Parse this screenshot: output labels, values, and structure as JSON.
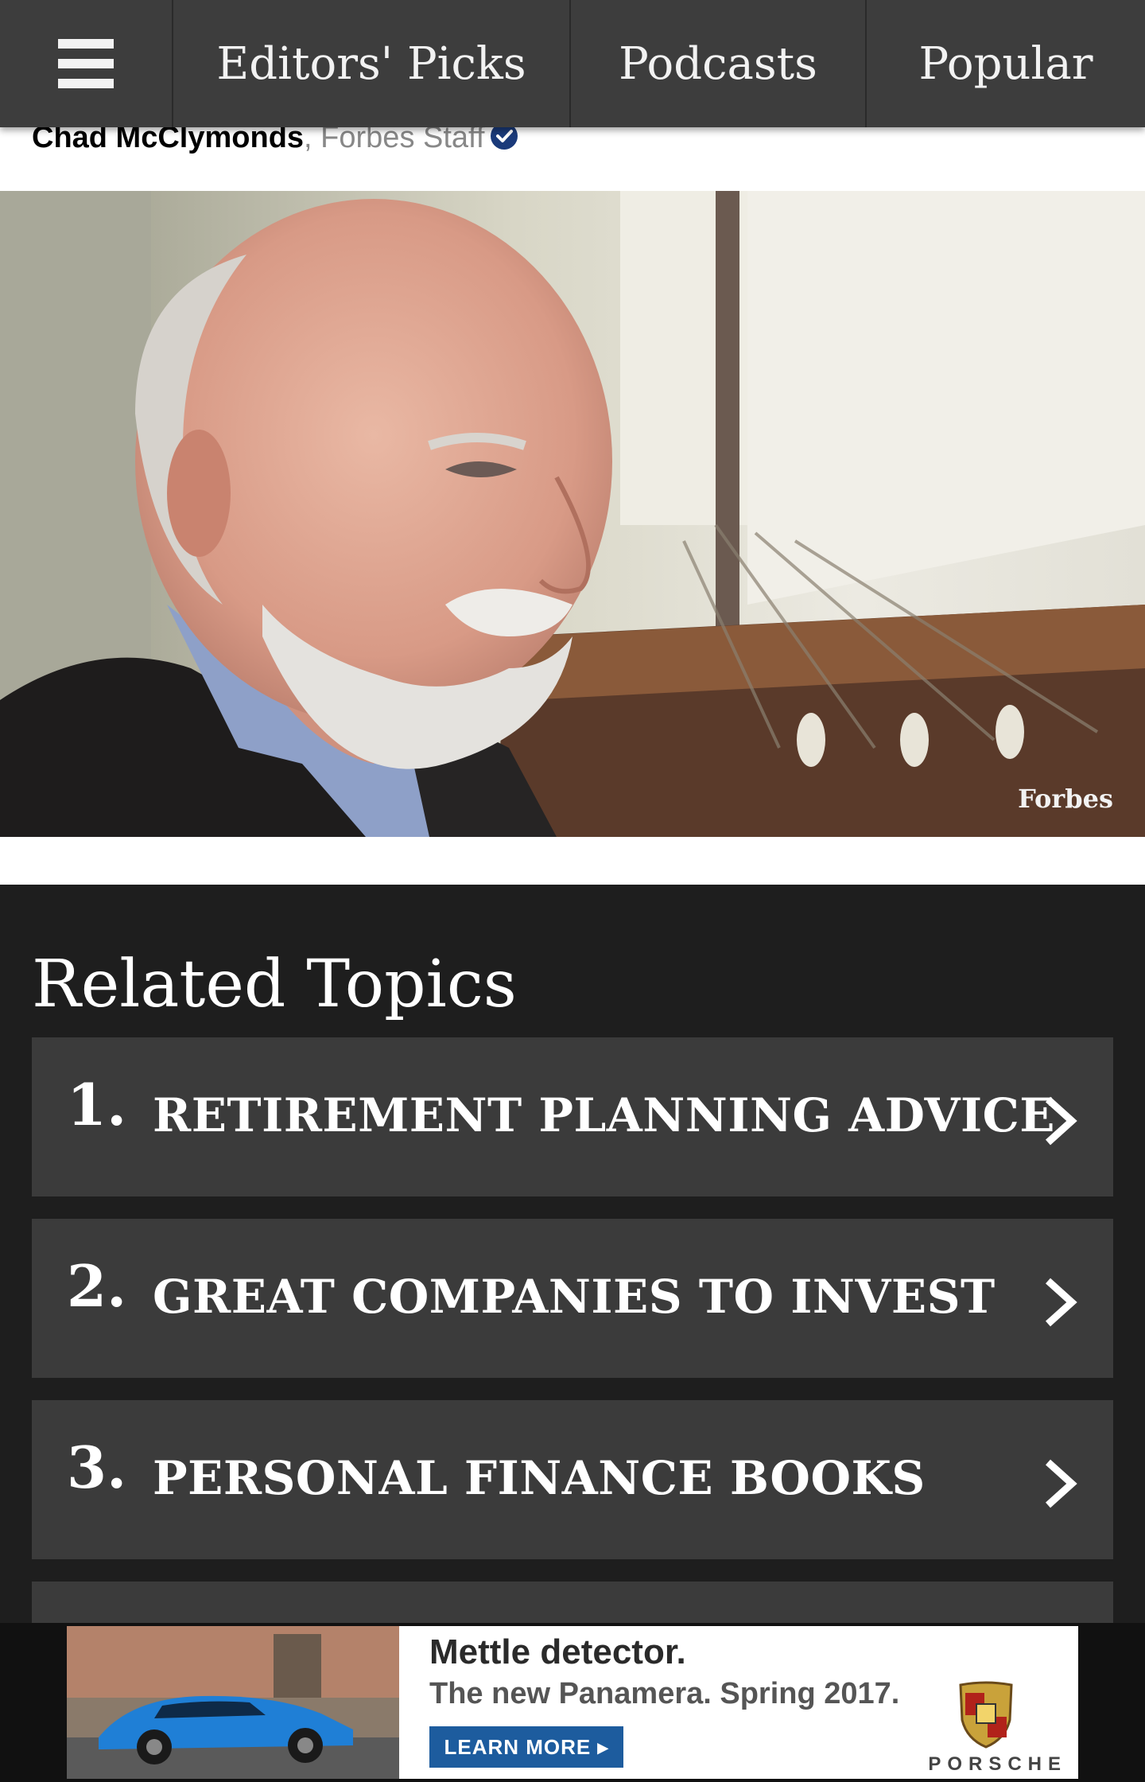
{
  "nav": {
    "items": [
      "Editors' Picks",
      "Podcasts",
      "Popular"
    ]
  },
  "byline": {
    "author": "Chad McClymonds",
    "separator": ",",
    "role": "Forbes Staff"
  },
  "photo": {
    "watermark": "Forbes"
  },
  "related": {
    "title": "Related Topics",
    "topics": [
      {
        "num": "1.",
        "label": "RETIREMENT PLANNING ADVICE"
      },
      {
        "num": "2.",
        "label": "GREAT COMPANIES TO INVEST"
      },
      {
        "num": "3.",
        "label": "PERSONAL FINANCE BOOKS"
      }
    ]
  },
  "ad": {
    "headline": "Mettle detector.",
    "subline": "The new Panamera. Spring 2017.",
    "cta": "LEARN MORE ▸",
    "brand": "PORSCHE"
  },
  "colors": {
    "nav_bg": "#3d3d3d",
    "page_bg": "#1e1e1e",
    "topic_bg": "#3b3b3b",
    "verified": "#1a3a7a",
    "ad_cta": "#1d5c9e"
  }
}
